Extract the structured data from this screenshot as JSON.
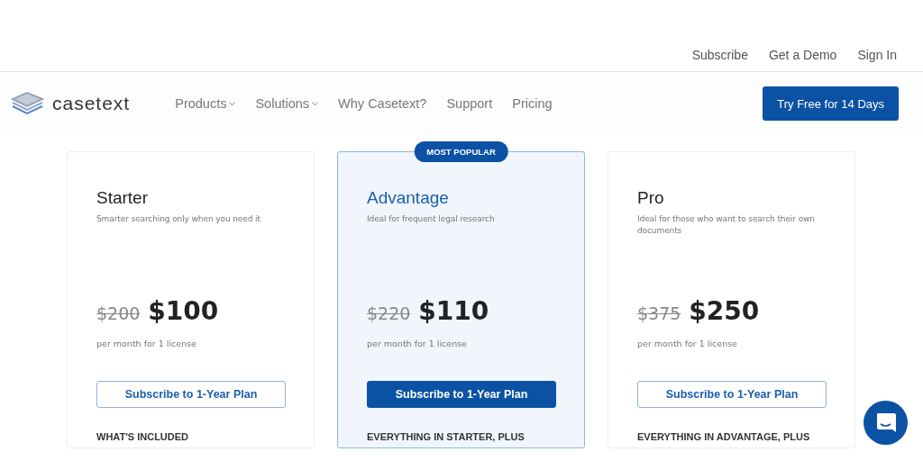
{
  "top_links": [
    "Subscribe",
    "Get a Demo",
    "Sign In"
  ],
  "nav": {
    "logo": "casetext",
    "items": [
      {
        "label": "Products",
        "dropdown": true
      },
      {
        "label": "Solutions",
        "dropdown": true
      },
      {
        "label": "Why Casetext?",
        "dropdown": false
      },
      {
        "label": "Support",
        "dropdown": false
      },
      {
        "label": "Pricing",
        "dropdown": false
      }
    ],
    "cta": "Try Free for 14 Days"
  },
  "plans": [
    {
      "name": "Starter",
      "featured": false,
      "description": "Smarter searching only when you need it",
      "old_price": "$200",
      "price": "$100",
      "period": "per month for 1 license",
      "button": "Subscribe to 1-Year Plan",
      "includes": "WHAT'S INCLUDED"
    },
    {
      "name": "Advantage",
      "featured": true,
      "badge": "MOST POPULAR",
      "description": "Ideal for frequent legal research",
      "old_price": "$220",
      "price": "$110",
      "period": "per month for 1 license",
      "button": "Subscribe to 1-Year Plan",
      "includes": "EVERYTHING IN STARTER, PLUS"
    },
    {
      "name": "Pro",
      "featured": false,
      "description": "Ideal for those who want to search their own documents",
      "old_price": "$375",
      "price": "$250",
      "period": "per month for 1 license",
      "button": "Subscribe to 1-Year Plan",
      "includes": "EVERYTHING IN ADVANTAGE, PLUS"
    }
  ]
}
